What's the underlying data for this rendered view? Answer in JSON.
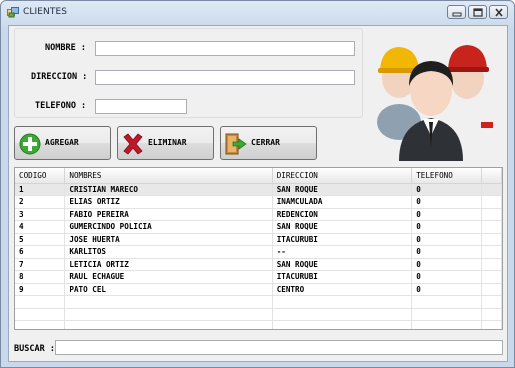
{
  "window": {
    "title": "CLIENTES"
  },
  "form": {
    "nombre_label": "NOMBRE :",
    "nombre_value": "",
    "direccion_label": "DIRECCION :",
    "direccion_value": "",
    "telefono_label": "TELEFONO :",
    "telefono_value": ""
  },
  "buttons": {
    "agregar": "AGREGAR",
    "eliminar": "ELIMINAR",
    "cerrar": "CERRAR"
  },
  "grid": {
    "columns": [
      "CODIGO",
      "NOMBRES",
      "DIRECCION",
      "TELEFONO"
    ],
    "rows": [
      [
        "1",
        "CRISTIAN MARECO",
        "SAN ROQUE",
        "0"
      ],
      [
        "2",
        "ELIAS ORTIZ",
        "INAMCULADA",
        "0"
      ],
      [
        "3",
        "FABIO PEREIRA",
        "REDENCION",
        "0"
      ],
      [
        "4",
        "GUMERCINDO POLICIA",
        "SAN ROQUE",
        "0"
      ],
      [
        "5",
        "JOSE HUERTA",
        "ITACURUBI",
        "0"
      ],
      [
        "6",
        "KARLITOS",
        "--",
        "0"
      ],
      [
        "7",
        "LETICIA ORTIZ",
        "SAN ROQUE",
        "0"
      ],
      [
        "8",
        "RAUL ECHAGUE",
        "ITACURUBI",
        "0"
      ],
      [
        "9",
        "PATO CEL",
        "CENTRO",
        "0"
      ]
    ]
  },
  "search": {
    "label": "BUSCAR :",
    "value": ""
  },
  "icons": {
    "title": "app-window-icon",
    "agregar": "plus-circle-icon",
    "eliminar": "red-x-icon",
    "cerrar": "exit-door-icon",
    "people": "people-group-icon"
  },
  "colors": {
    "add_green": "#3da832",
    "delete_red": "#c0182a",
    "selected_row": "#e8e8e8"
  }
}
